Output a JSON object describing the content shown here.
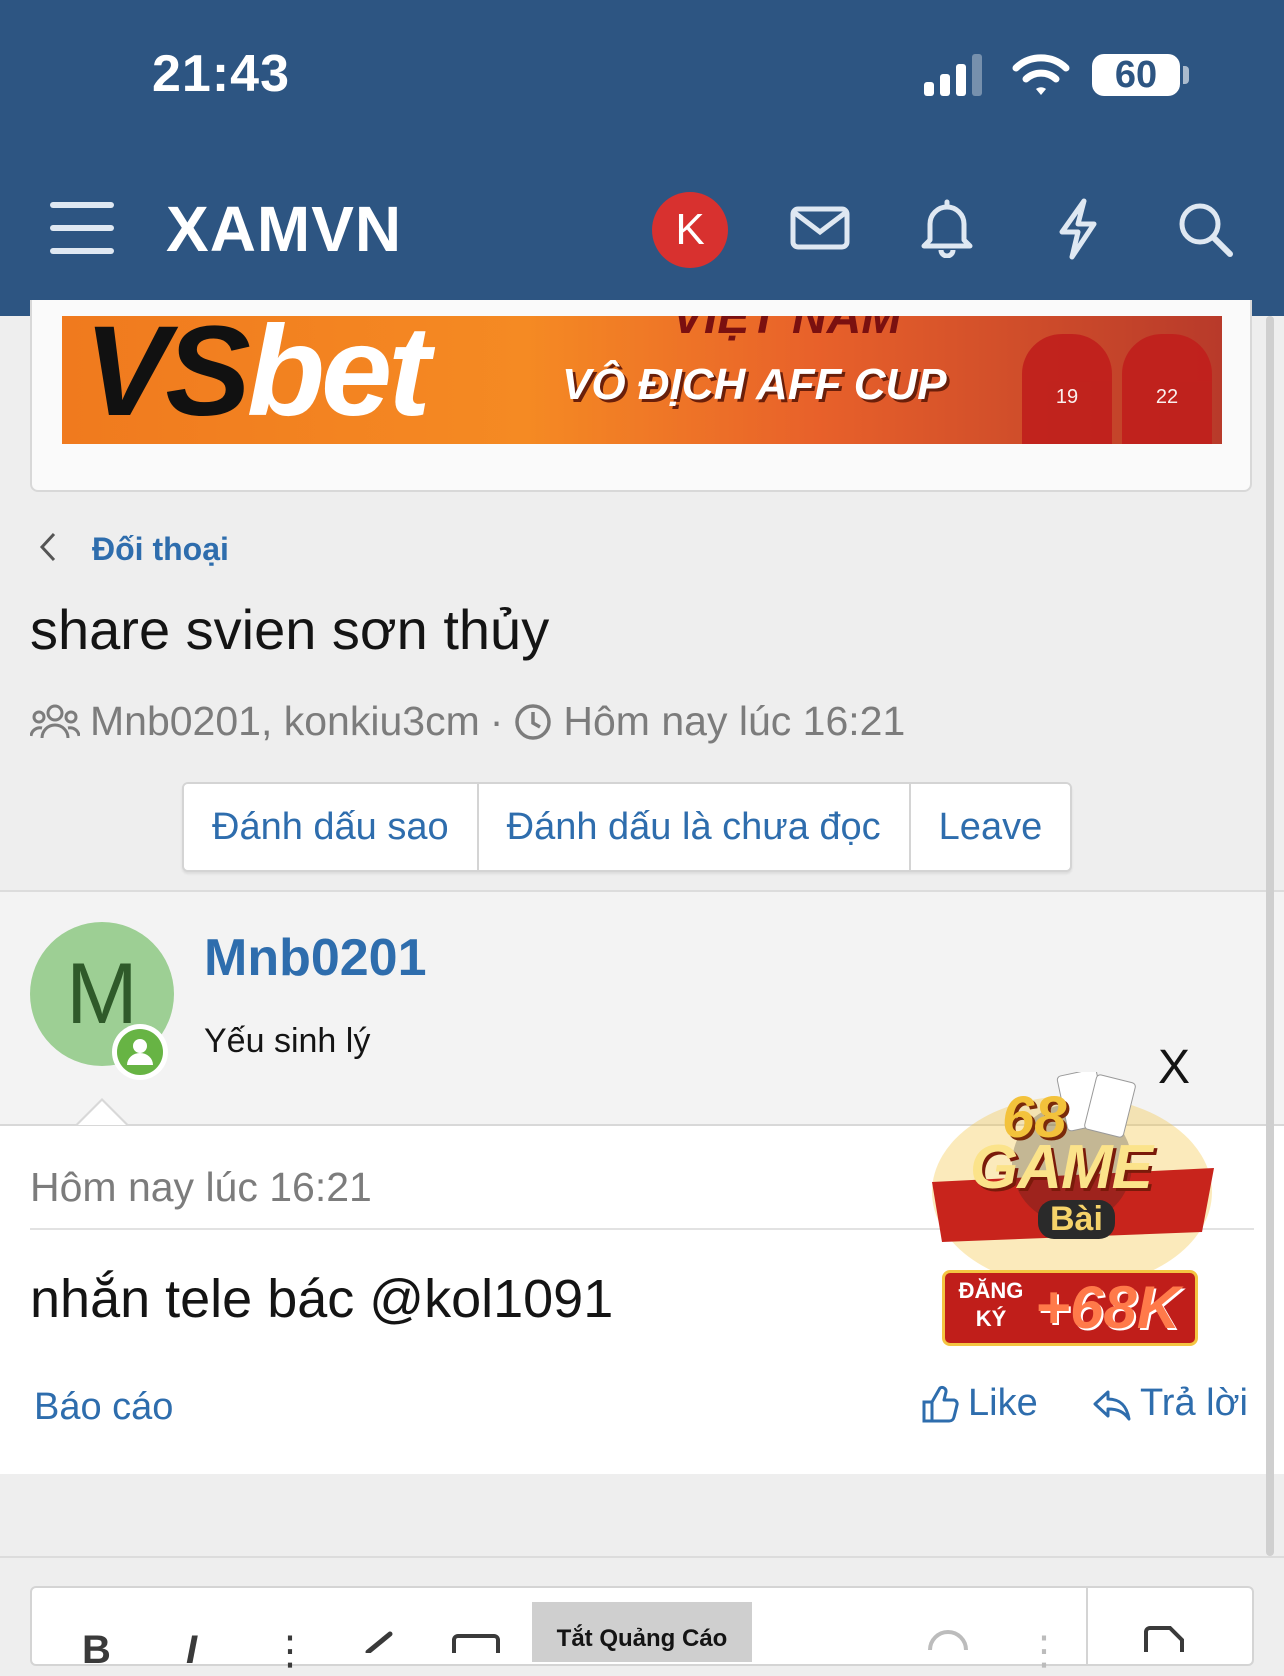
{
  "status_bar": {
    "time": "21:43",
    "battery": "60"
  },
  "header": {
    "logo": "XAMVN",
    "avatar_letter": "K"
  },
  "banner": {
    "brand_left": "VS",
    "brand_right": "bet",
    "headline": "VIỆT NAM",
    "slogan": "VÔ ĐỊCH AFF CUP",
    "player_numbers": [
      "19",
      "22"
    ]
  },
  "breadcrumb": {
    "label": "Đối thoại"
  },
  "conversation": {
    "title": "share svien sơn thủy",
    "participants": "Mnb0201, konkiu3cm",
    "separator": "·",
    "started": "Hôm nay lúc 16:21"
  },
  "actions": {
    "star": "Đánh dấu sao",
    "mark_unread": "Đánh dấu là chưa đọc",
    "leave": "Leave"
  },
  "message": {
    "avatar_letter": "M",
    "username": "Mnb0201",
    "user_title": "Yếu sinh lý",
    "time": "Hôm nay lúc 16:21",
    "text": "nhắn tele bác @kol1091",
    "report": "Báo cáo",
    "like": "Like",
    "reply": "Trả lời"
  },
  "floating_ad": {
    "close": "X",
    "number": "68",
    "game": "GAME",
    "bai": "Bài",
    "register": "ĐĂNG KÝ",
    "bonus": "+68K"
  },
  "editor": {
    "bold": "B",
    "italic": "I",
    "more": "⋮",
    "ads_off": "Tắt Quảng Cáo"
  },
  "colors": {
    "header_bg": "#2d5582",
    "link": "#2e6dad",
    "avatar_k": "#d8312f",
    "avatar_m": "#9dcf94",
    "online": "#67b444"
  }
}
